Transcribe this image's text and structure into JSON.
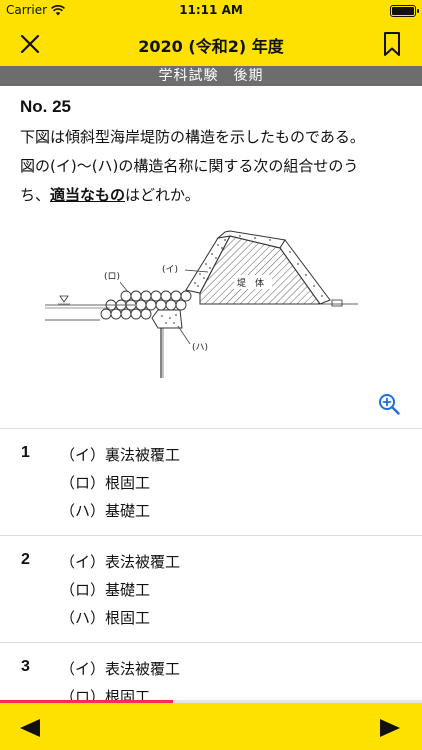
{
  "status": {
    "carrier": "Carrier",
    "time": "11:11 AM",
    "battery_level": 1.0
  },
  "nav": {
    "title": "2020 (令和2) 年度",
    "close_icon": "close-icon",
    "bookmark_icon": "bookmark-icon"
  },
  "exam": {
    "label": "学科試験　後期"
  },
  "question": {
    "number": "No. 25",
    "line1": "下図は傾斜型海岸堤防の構造を示したものである。",
    "line2": "図の(イ)〜(ハ)の構造名称に関する次の組合せのう",
    "line3_pre": "ち、",
    "line3_emph": "適当なもの",
    "line3_post": "はどれか。"
  },
  "figure": {
    "label_i": "(イ)",
    "label_ro": "(ロ)",
    "label_ha": "(ハ)",
    "label_body": "堤　体"
  },
  "choices": [
    {
      "num": "1",
      "i": "（イ）裏法被覆工",
      "ro": "（ロ）根固工",
      "ha": "（ハ）基礎工"
    },
    {
      "num": "2",
      "i": "（イ）表法被覆工",
      "ro": "（ロ）基礎工",
      "ha": "（ハ）根固工"
    },
    {
      "num": "3",
      "i": "（イ）表法被覆工",
      "ro": "（ロ）根固工",
      "ha": ""
    }
  ],
  "progress": 0.41,
  "colors": {
    "accent": "#ffe100",
    "progress": "#ff2a5d",
    "subheader": "#6d6d6d"
  }
}
